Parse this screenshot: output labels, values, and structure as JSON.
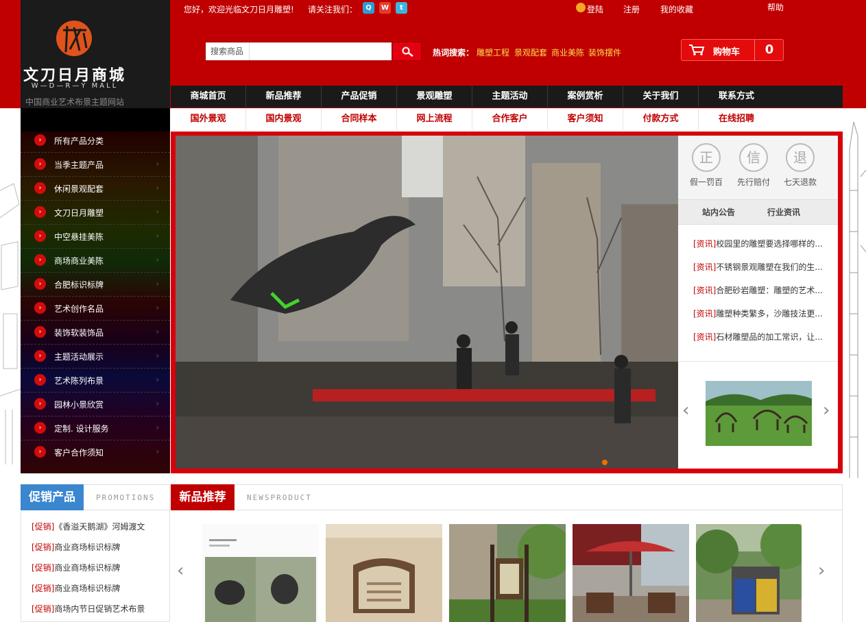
{
  "logo": {
    "name_cn": "文刀日月商城",
    "name_en": "W—D—R—Y MALL",
    "tagline": "中国商业艺术布景主题网站"
  },
  "topbar": {
    "welcome": "您好，欢迎光临文刀日月雕塑!",
    "follow": "请关注我们：",
    "login": "登陆",
    "register": "注册",
    "favorites": "我的收藏",
    "help": "帮助"
  },
  "search": {
    "category": "搜索商品",
    "value": "",
    "hot_label": "热词搜索：",
    "hot_words": [
      "雕塑工程",
      "景观配套",
      "商业美陈",
      "装饰摆件"
    ]
  },
  "cart": {
    "label": "购物车",
    "count": "0"
  },
  "nav_primary": [
    "商城首页",
    "新品推荐",
    "产品促销",
    "景观雕塑",
    "主题活动",
    "案例赏析",
    "关于我们",
    "联系方式"
  ],
  "nav_secondary": [
    "国外景观",
    "国内景观",
    "合同样本",
    "网上流程",
    "合作客户",
    "客户须知",
    "付款方式",
    "在线招聘"
  ],
  "sidebar": [
    "所有产品分类",
    "当季主题产品",
    "休闲景观配套",
    "文刀日月雕塑",
    "中空悬挂美陈",
    "商场商业美陈",
    "合肥标识标牌",
    "艺术创作名品",
    "装饰软装饰品",
    "主题活动展示",
    "艺术陈列布景",
    "园林小景欣赏",
    "定制. 设计服务",
    "客户合作须知"
  ],
  "guarantees": [
    {
      "glyph": "正",
      "label": "假一罚百"
    },
    {
      "glyph": "信",
      "label": "先行赔付"
    },
    {
      "glyph": "退",
      "label": "七天退款"
    }
  ],
  "tabs": [
    "站内公告",
    "行业资讯"
  ],
  "news": [
    {
      "tag": "[资讯]",
      "title": "校园里的雕塑要选择哪样的..."
    },
    {
      "tag": "[资讯]",
      "title": "不锈钢景观雕塑在我们的生..."
    },
    {
      "tag": "[资讯]",
      "title": "合肥砂岩雕塑：雕塑的艺术..."
    },
    {
      "tag": "[资讯]",
      "title": "雕塑种类繁多，沙雕技法更..."
    },
    {
      "tag": "[资讯]",
      "title": "石材雕塑品的加工常识，让..."
    }
  ],
  "promotions": {
    "title": "促销产品",
    "subtitle": "PROMOTIONS",
    "items": [
      {
        "tag": "[促销]",
        "title": "《香溢天鹅湖》河姆渡文"
      },
      {
        "tag": "[促销]",
        "title": "商业商场标识标牌"
      },
      {
        "tag": "[促销]",
        "title": "商业商场标识标牌"
      },
      {
        "tag": "[促销]",
        "title": "商业商场标识标牌"
      },
      {
        "tag": "[促销]",
        "title": "商场内节日促销艺术布景"
      }
    ]
  },
  "new_products": {
    "title": "新品推荐",
    "subtitle": "NEWSPRODUCT"
  },
  "icons": {
    "social": [
      "qq-icon",
      "weibo-icon",
      "tencent-weibo-icon"
    ],
    "cart": "cart-icon",
    "search": "magnifier-icon"
  },
  "colors": {
    "brand_red": "#c00000",
    "nav_dark": "#1a1a1a",
    "promo_blue": "#3a86cf",
    "hot_word": "#ffdd55"
  }
}
